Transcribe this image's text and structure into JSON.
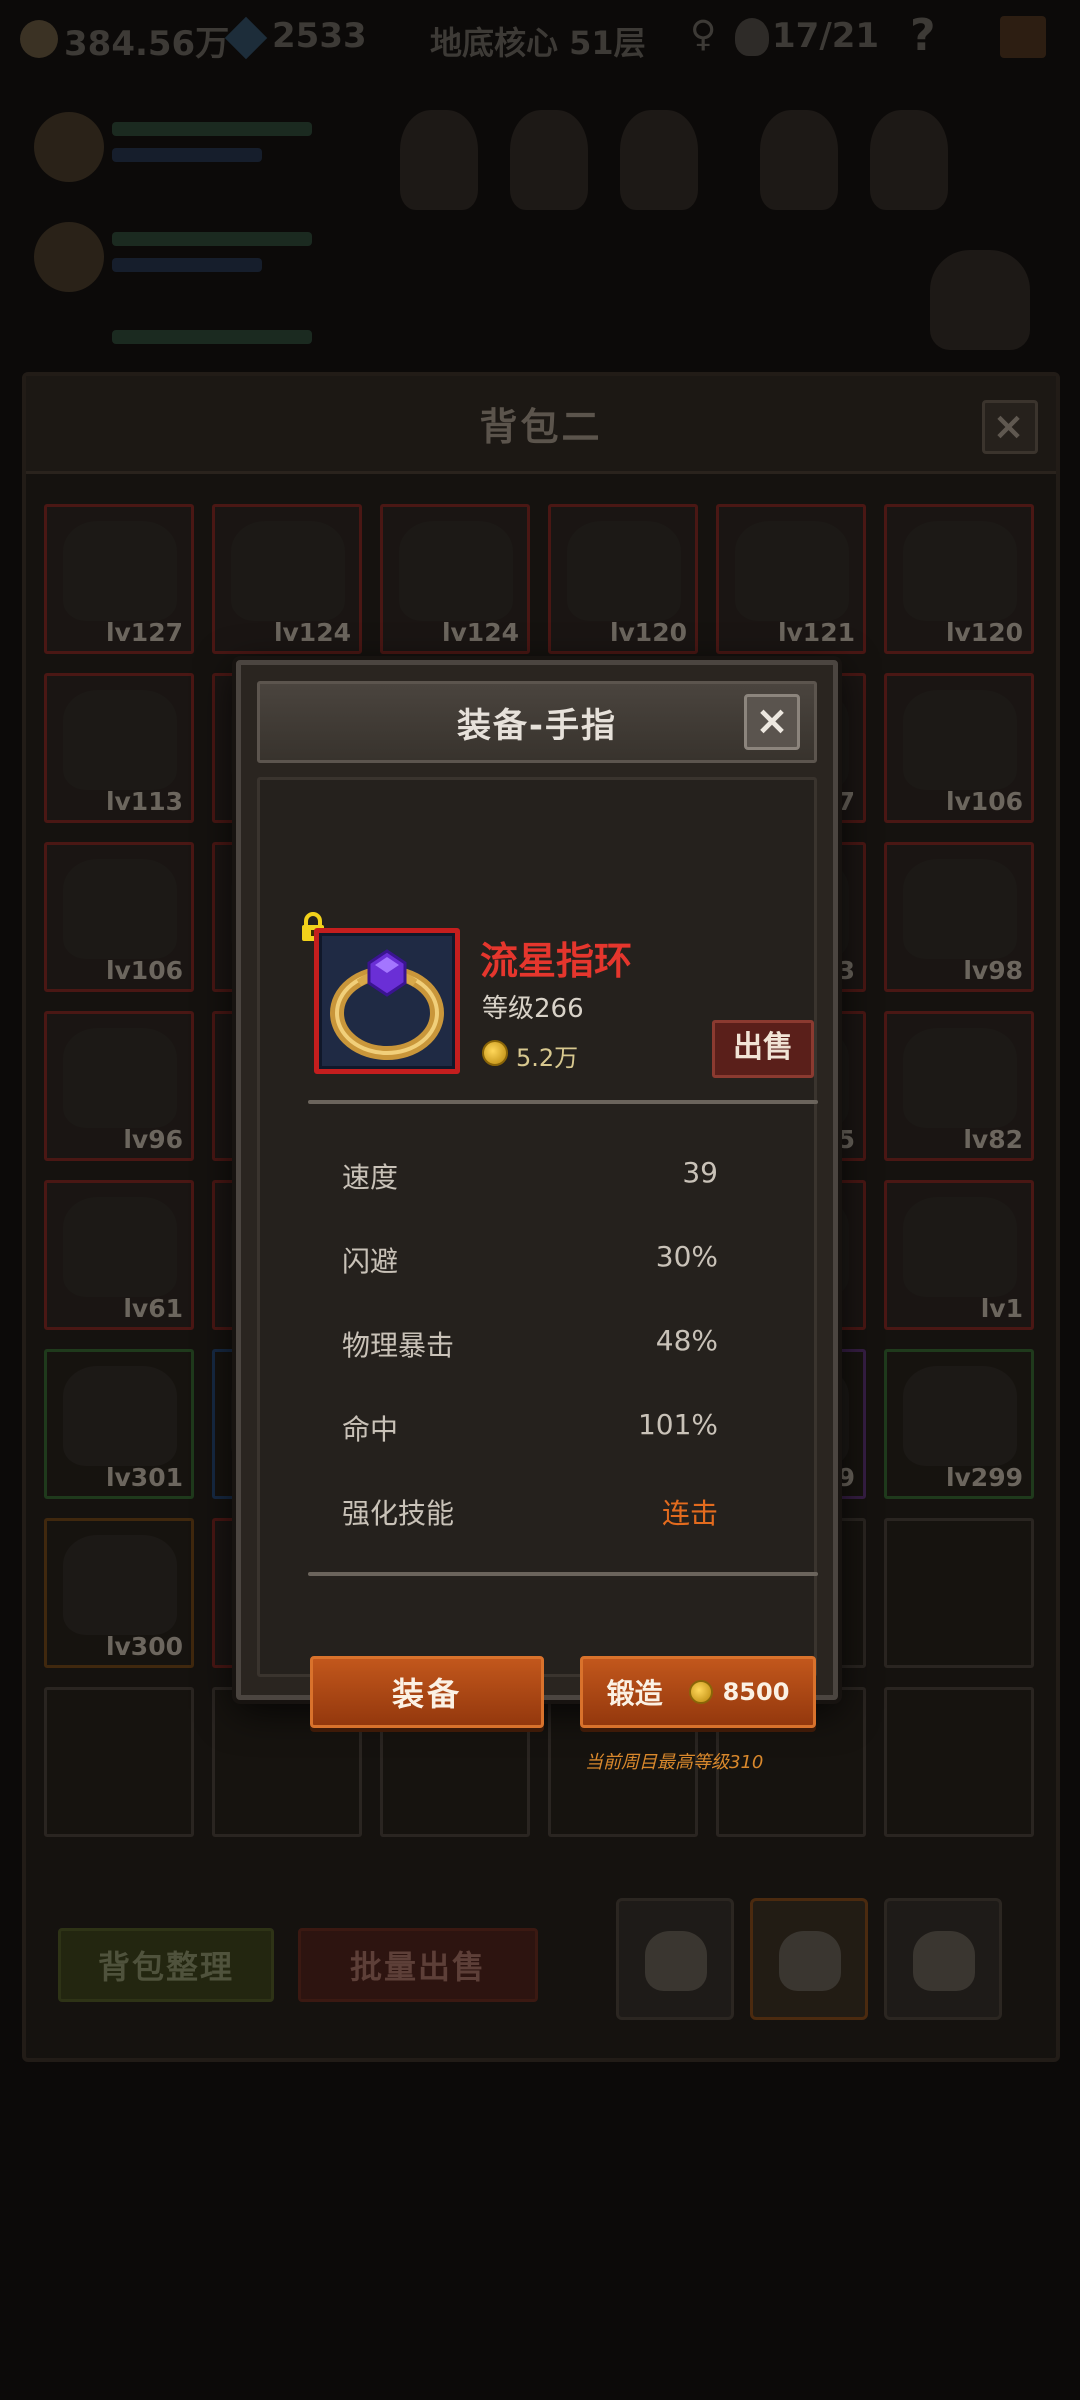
{
  "hud": {
    "gold": "384.56万",
    "gems": "2533",
    "floor": "地底核心 51层",
    "kills": "17/21",
    "help": "?"
  },
  "bag": {
    "title": "背包二",
    "close": "×",
    "items": [
      {
        "lv": "lv127",
        "frame": "red"
      },
      {
        "lv": "lv124",
        "frame": "red"
      },
      {
        "lv": "lv124",
        "frame": "red"
      },
      {
        "lv": "lv120",
        "frame": "red"
      },
      {
        "lv": "lv121",
        "frame": "red"
      },
      {
        "lv": "lv120",
        "frame": "red"
      },
      {
        "lv": "lv113",
        "frame": "red"
      },
      {
        "lv": "",
        "frame": "red"
      },
      {
        "lv": "",
        "frame": "red"
      },
      {
        "lv": "",
        "frame": "red"
      },
      {
        "lv": "7",
        "frame": "red"
      },
      {
        "lv": "lv106",
        "frame": "red"
      },
      {
        "lv": "lv106",
        "frame": "red"
      },
      {
        "lv": "",
        "frame": "red"
      },
      {
        "lv": "",
        "frame": "red"
      },
      {
        "lv": "",
        "frame": "red"
      },
      {
        "lv": "3",
        "frame": "red"
      },
      {
        "lv": "lv98",
        "frame": "red"
      },
      {
        "lv": "lv96",
        "frame": "red"
      },
      {
        "lv": "",
        "frame": "red"
      },
      {
        "lv": "",
        "frame": "red"
      },
      {
        "lv": "",
        "frame": "red"
      },
      {
        "lv": "5",
        "frame": "red"
      },
      {
        "lv": "lv82",
        "frame": "red"
      },
      {
        "lv": "lv61",
        "frame": "red"
      },
      {
        "lv": "",
        "frame": "red"
      },
      {
        "lv": "",
        "frame": "red"
      },
      {
        "lv": "",
        "frame": "red"
      },
      {
        "lv": "",
        "frame": "red"
      },
      {
        "lv": "lv1",
        "frame": "red"
      },
      {
        "lv": "lv301",
        "frame": "green"
      },
      {
        "lv": "",
        "frame": "blue"
      },
      {
        "lv": "",
        "frame": "red"
      },
      {
        "lv": "",
        "frame": "red"
      },
      {
        "lv": "9",
        "frame": "purple"
      },
      {
        "lv": "lv299",
        "frame": "green"
      },
      {
        "lv": "lv300",
        "frame": "orange"
      },
      {
        "lv": "",
        "frame": "red"
      },
      {
        "lv": "",
        "frame": "none"
      },
      {
        "lv": "",
        "frame": "none"
      },
      {
        "lv": "",
        "frame": "none"
      },
      {
        "lv": "",
        "frame": "none"
      },
      {
        "lv": "",
        "frame": "none"
      },
      {
        "lv": "",
        "frame": "none"
      },
      {
        "lv": "",
        "frame": "none"
      },
      {
        "lv": "",
        "frame": "none"
      },
      {
        "lv": "",
        "frame": "none"
      },
      {
        "lv": "",
        "frame": "none"
      }
    ],
    "sort_label": "背包整理",
    "bulk_sell_label": "批量出售"
  },
  "modal": {
    "title": "装备-手指",
    "close": "×",
    "item": {
      "name": "流星指环",
      "level": "等级266",
      "price": "5.2万",
      "icon": "ring-icon",
      "locked": true
    },
    "sell_label": "出售",
    "stats": [
      {
        "label": "速度",
        "value": "39"
      },
      {
        "label": "闪避",
        "value": "30%"
      },
      {
        "label": "物理暴击",
        "value": "48%"
      },
      {
        "label": "命中",
        "value": "101%"
      },
      {
        "label": "强化技能",
        "value": "连击"
      }
    ],
    "equip_label": "装备",
    "forge_label": "锻造",
    "forge_cost": "8500",
    "max_level_note": "当前周目最高等级310"
  },
  "colors": {
    "item_name": "#e5362d",
    "skill_value": "#e36b1e",
    "button_orange": "#c2571c"
  }
}
